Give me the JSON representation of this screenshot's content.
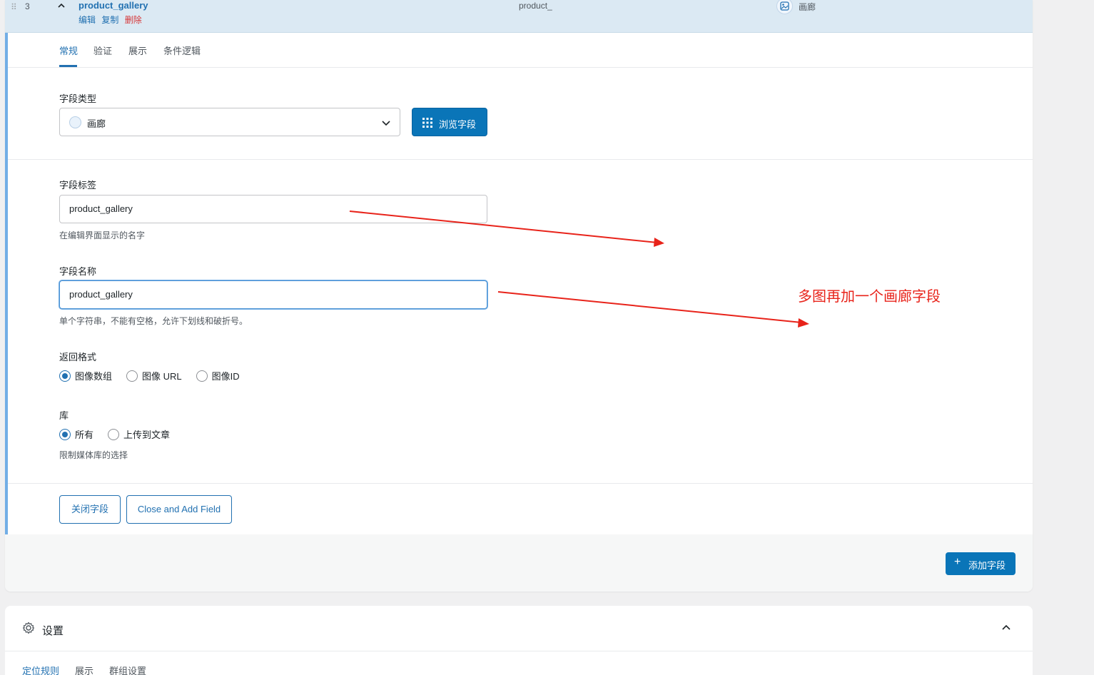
{
  "field_row": {
    "order": "3",
    "title": "product_gallery",
    "actions": {
      "edit": "编辑",
      "duplicate": "复制",
      "delete": "删除"
    },
    "key": "product_",
    "type_label": "画廊"
  },
  "tabs": [
    "常规",
    "验证",
    "展示",
    "条件逻辑"
  ],
  "field_type": {
    "label": "字段类型",
    "value": "画廊",
    "browse_button": "浏览字段"
  },
  "field_label": {
    "label": "字段标签",
    "value": "product_gallery",
    "hint": "在编辑界面显示的名字"
  },
  "field_name": {
    "label": "字段名称",
    "value": "product_gallery",
    "hint": "单个字符串，不能有空格，允许下划线和破折号。"
  },
  "return_format": {
    "label": "返回格式",
    "options": [
      "图像数组",
      "图像 URL",
      "图像ID"
    ],
    "selected": "图像数组"
  },
  "library": {
    "label": "库",
    "options": [
      "所有",
      "上传到文章"
    ],
    "selected": "所有",
    "hint": "限制媒体库的选择"
  },
  "buttons": {
    "close_field": "关闭字段",
    "close_and_add": "Close and Add Field",
    "add_field": "添加字段"
  },
  "settings": {
    "title": "设置",
    "tabs": [
      "定位规则",
      "展示",
      "群组设置"
    ]
  },
  "annotation": {
    "text": "多图再加一个画廊字段",
    "color": "#e8231a"
  },
  "colors": {
    "accent": "#2271b1",
    "button_primary": "#0a75b8",
    "row_highlight": "#dbe9f3",
    "delete": "#d63638"
  }
}
